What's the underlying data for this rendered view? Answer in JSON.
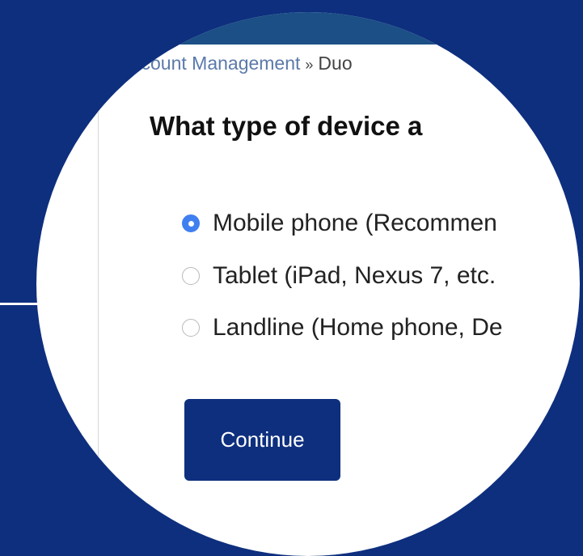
{
  "breadcrumb": {
    "parent": "ccount Management",
    "separator": "»",
    "current": "Duo"
  },
  "question": {
    "heading": "What type of device a"
  },
  "device_options": [
    {
      "label": "Mobile phone (Recommen",
      "selected": true
    },
    {
      "label": "Tablet (iPad, Nexus 7, etc.",
      "selected": false
    },
    {
      "label": "Landline (Home phone, De",
      "selected": false
    }
  ],
  "actions": {
    "continue_label": "Continue"
  },
  "colors": {
    "background": "#0e2f7e",
    "button": "#0e2f7e",
    "radio_selected": "#3f7ff0",
    "link": "#5b79aa"
  }
}
